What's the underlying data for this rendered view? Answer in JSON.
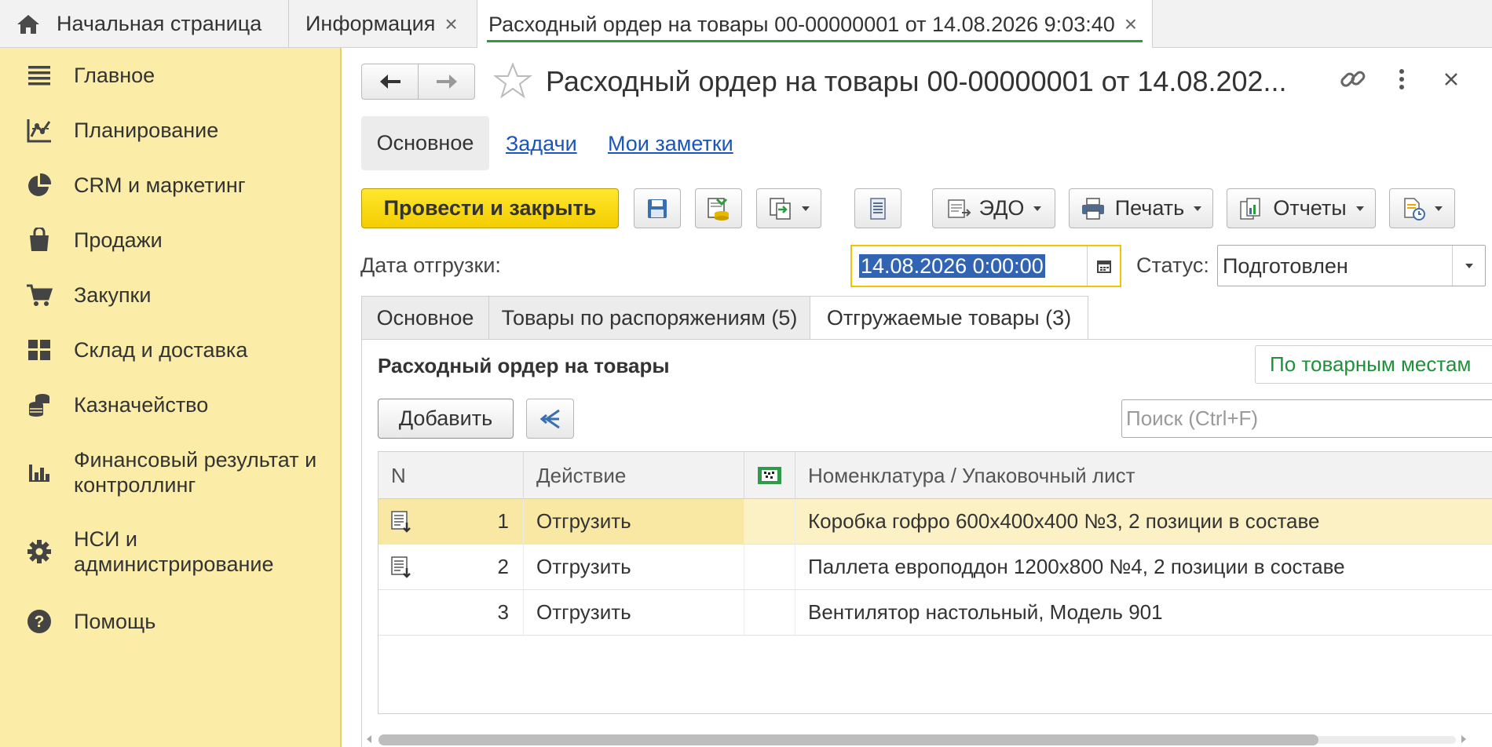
{
  "tabs": {
    "home": "Начальная страница",
    "info": "Информация",
    "doc": "Расходный ордер на товары 00-00000001 от 14.08.2026 9:03:40",
    "close_glyph": "×"
  },
  "sidebar": {
    "items": [
      {
        "label": "Главное",
        "icon": "menu-lines-icon"
      },
      {
        "label": "Планирование",
        "icon": "planning-chart-icon"
      },
      {
        "label": "CRM и маркетинг",
        "icon": "pie-chart-icon"
      },
      {
        "label": "Продажи",
        "icon": "shopping-bag-icon"
      },
      {
        "label": "Закупки",
        "icon": "cart-icon"
      },
      {
        "label": "Склад и доставка",
        "icon": "warehouse-grid-icon"
      },
      {
        "label": "Казначейство",
        "icon": "coins-icon"
      },
      {
        "label": "Финансовый результат и контроллинг",
        "icon": "bar-chart-icon"
      },
      {
        "label": "НСИ и администрирование",
        "icon": "gear-icon"
      },
      {
        "label": "Помощь",
        "icon": "help-icon"
      }
    ]
  },
  "form": {
    "title": "Расходный ордер на товары 00-00000001 от 14.08.202...",
    "tabs": {
      "main": "Основное",
      "tasks": "Задачи",
      "notes": "Мои заметки"
    }
  },
  "toolbar": {
    "post_close": "Провести и закрыть",
    "edo": "ЭДО",
    "print": "Печать",
    "reports": "Отчеты"
  },
  "fields": {
    "date_label": "Дата отгрузки:",
    "date_value": "14.08.2026  0:00:00",
    "status_label": "Статус:",
    "status_value": "Подготовлен"
  },
  "inner_tabs": {
    "main": "Основное",
    "by_orders": "Товары по распоряжениям (5)",
    "shipped": "Отгружаемые товары (3)"
  },
  "section": {
    "title": "Расходный ордер на товары",
    "by_packages": "По товарным местам",
    "add": "Добавить",
    "search_placeholder": "Поиск (Ctrl+F)"
  },
  "table": {
    "headers": {
      "n": "N",
      "action": "Действие",
      "nomenclature": "Номенклатура / Упаковочный лист"
    },
    "rows": [
      {
        "n": "1",
        "action": "Отгрузить",
        "nomenclature": "Коробка гофро 600х400х400 №3, 2 позиции в составе"
      },
      {
        "n": "2",
        "action": "Отгрузить",
        "nomenclature": "Паллета европоддон 1200х800 №4, 2 позиции в составе"
      },
      {
        "n": "3",
        "action": "Отгрузить",
        "nomenclature": "Вентилятор настольный, Модель 901"
      }
    ]
  },
  "colors": {
    "sidebar_bg": "#fbeda8",
    "primary_button": "#f7d600",
    "link": "#1a55b8",
    "active_tab_underline": "#2a9d3f",
    "selected_row": "#fbf1c4"
  }
}
